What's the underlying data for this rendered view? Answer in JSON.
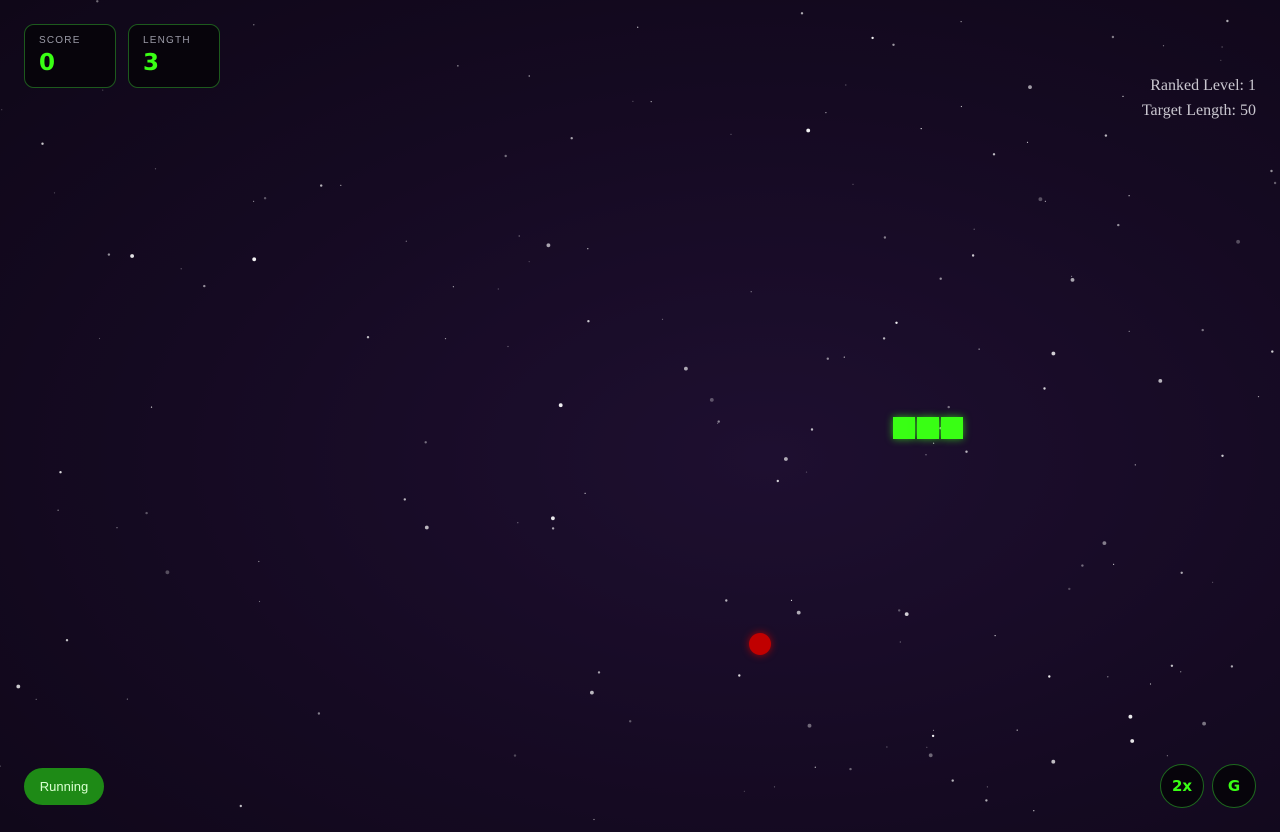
{
  "hud": {
    "score_label": "SCORE",
    "score_value": "0",
    "length_label": "LENGTH",
    "length_value": "3"
  },
  "ranked": {
    "level_text": "Ranked Level: 1",
    "target_text": "Target Length: 50"
  },
  "status": {
    "label": "Running"
  },
  "controls": {
    "speed_label": "2x",
    "grid_label": "G"
  },
  "colors": {
    "snake": "#39ff14",
    "food": "#c00000",
    "accent": "#39ff14",
    "status_bg": "#1e8a16"
  },
  "snake": {
    "segments": 3
  }
}
